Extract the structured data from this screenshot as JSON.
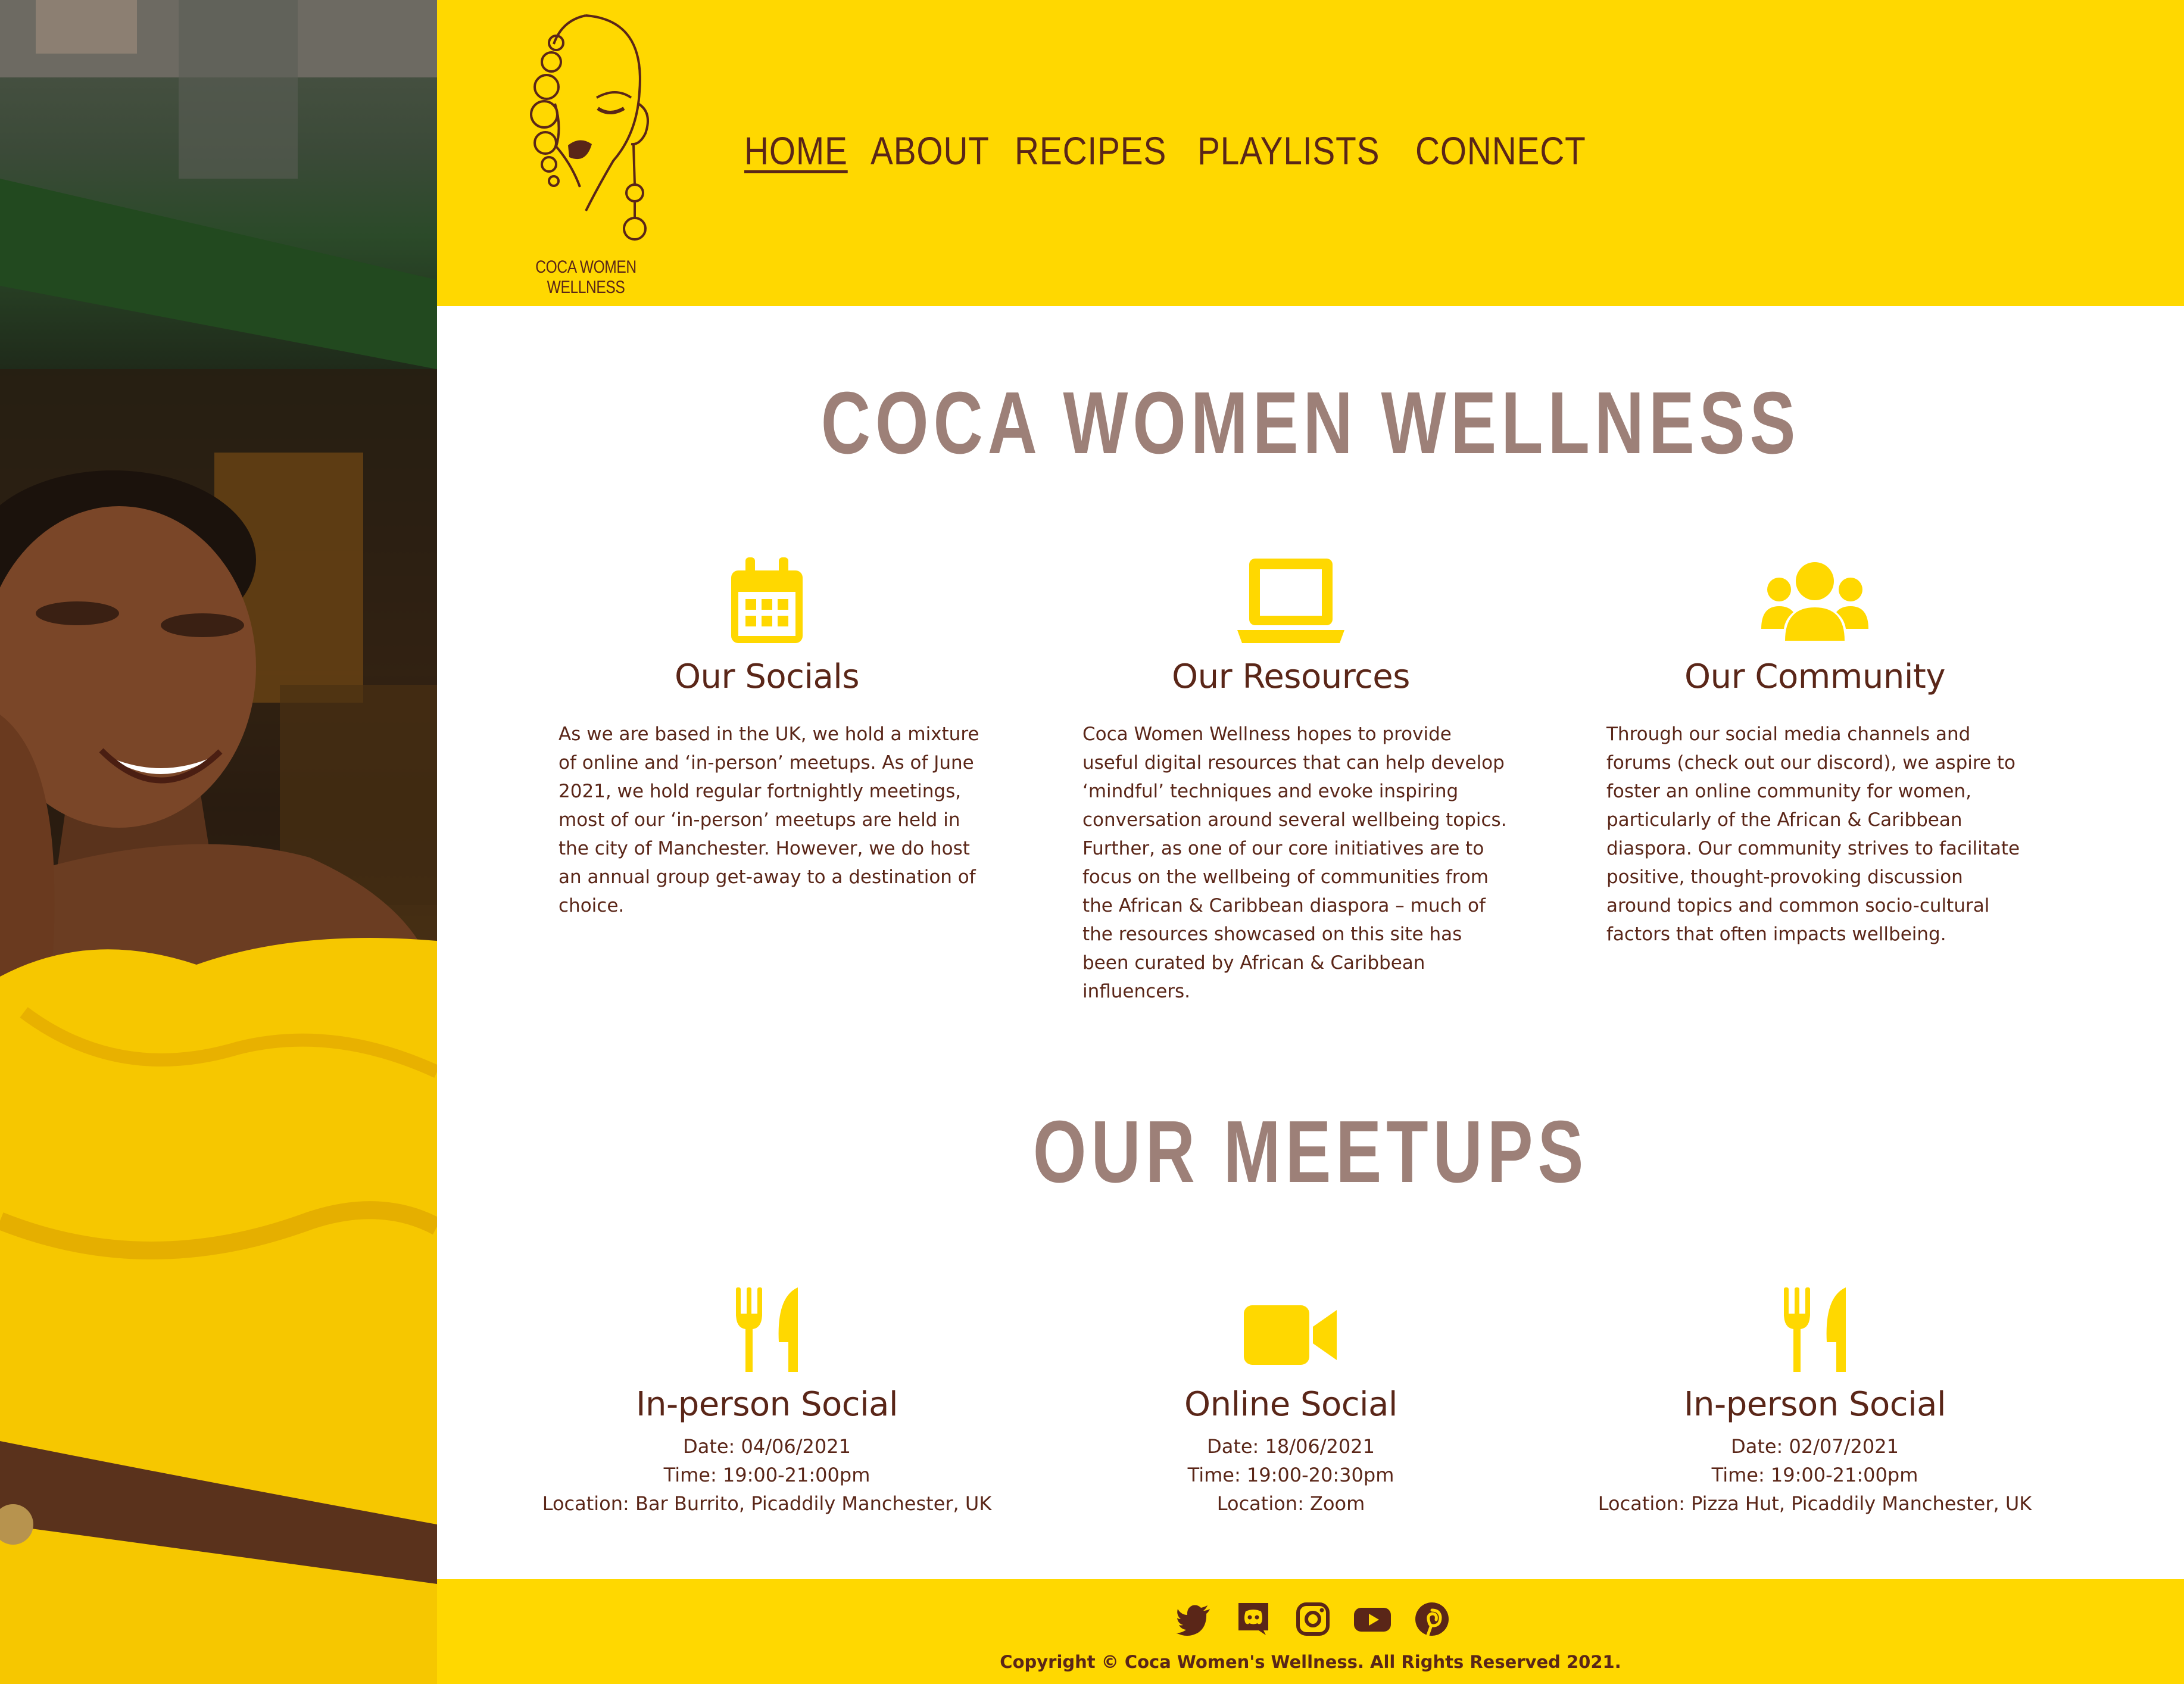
{
  "brand": {
    "logo_text": "COCA WOMEN WELLNESS",
    "yellow": "#ffd800",
    "brown": "#5a2618",
    "heading_color": "#9d8078"
  },
  "nav": [
    {
      "label": "HOME",
      "active": true
    },
    {
      "label": "ABOUT"
    },
    {
      "label": "RECIPES"
    },
    {
      "label": "PLAYLISTS"
    },
    {
      "label": "CONNECT"
    }
  ],
  "main": {
    "title": "COCA WOMEN WELLNESS",
    "features": [
      {
        "icon": "calendar-icon",
        "heading": "Our Socials",
        "text": "As we are based in the UK, we hold a mixture of online and ‘in-person’ meetups. As of June 2021, we hold regular fortnightly meetings, most of our ‘in-person’ meetups are held in the city of Manchester. However, we do host an annual group get-away to a destination of choice."
      },
      {
        "icon": "laptop-icon",
        "heading": "Our Resources",
        "text": "Coca Women Wellness hopes to provide useful digital resources that can help develop ‘mindful’ techniques and evoke inspiring conversation around several wellbeing topics. Further, as one of our core initiatives are to focus on the wellbeing of communities from the African & Caribbean diaspora – much of the resources showcased on this site has been curated by African & Caribbean influencers."
      },
      {
        "icon": "users-icon",
        "heading": "Our Community",
        "text": "Through our social media channels and forums (check out our discord), we aspire to foster an online community for women, particularly of the African & Caribbean diaspora. Our community strives to facilitate positive, thought-provoking discussion around topics and common socio-cultural factors that often impacts wellbeing."
      }
    ],
    "meetups_title": "OUR MEETUPS",
    "meetups": [
      {
        "icon": "utensils-icon",
        "heading": "In-person Social",
        "date": "Date: 04/06/2021",
        "time": "Time: 19:00-21:00pm",
        "location": "Location: Bar Burrito, Picaddily Manchester, UK"
      },
      {
        "icon": "video-camera-icon",
        "heading": "Online Social",
        "date": "Date: 18/06/2021",
        "time": "Time: 19:00-20:30pm",
        "location": "Location: Zoom"
      },
      {
        "icon": "utensils-icon",
        "heading": "In-person Social",
        "date": "Date: 02/07/2021",
        "time": "Time: 19:00-21:00pm",
        "location": "Location: Pizza Hut, Picaddily Manchester, UK"
      }
    ]
  },
  "footer": {
    "social_icons": [
      "twitter-icon",
      "discord-icon",
      "instagram-icon",
      "youtube-icon",
      "pinterest-icon"
    ],
    "copyright": "Copyright © Coca Women's Wellness. All Rights Reserved 2021."
  }
}
